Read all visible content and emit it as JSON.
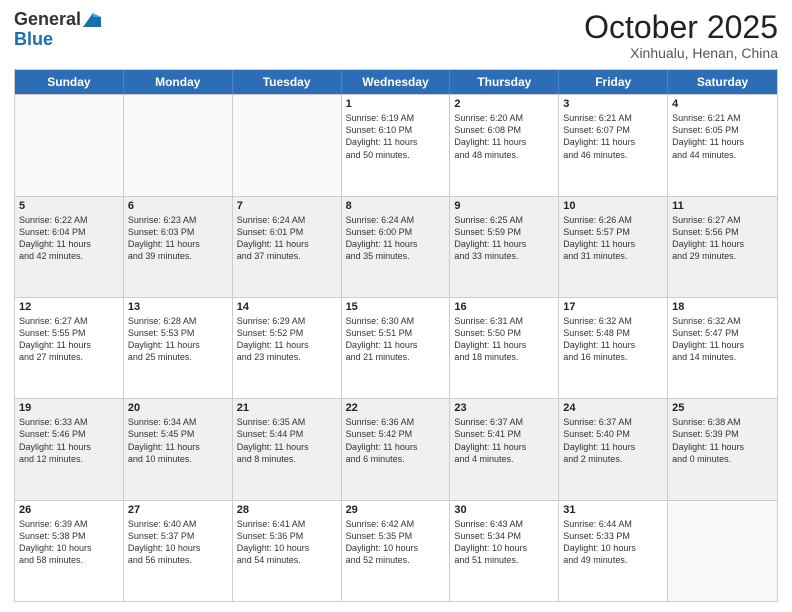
{
  "logo": {
    "line1": "General",
    "line2": "Blue"
  },
  "title": "October 2025",
  "location": "Xinhualu, Henan, China",
  "weekdays": [
    "Sunday",
    "Monday",
    "Tuesday",
    "Wednesday",
    "Thursday",
    "Friday",
    "Saturday"
  ],
  "rows": [
    [
      {
        "day": "",
        "info": "",
        "empty": true
      },
      {
        "day": "",
        "info": "",
        "empty": true
      },
      {
        "day": "",
        "info": "",
        "empty": true
      },
      {
        "day": "1",
        "info": "Sunrise: 6:19 AM\nSunset: 6:10 PM\nDaylight: 11 hours\nand 50 minutes."
      },
      {
        "day": "2",
        "info": "Sunrise: 6:20 AM\nSunset: 6:08 PM\nDaylight: 11 hours\nand 48 minutes."
      },
      {
        "day": "3",
        "info": "Sunrise: 6:21 AM\nSunset: 6:07 PM\nDaylight: 11 hours\nand 46 minutes."
      },
      {
        "day": "4",
        "info": "Sunrise: 6:21 AM\nSunset: 6:05 PM\nDaylight: 11 hours\nand 44 minutes."
      }
    ],
    [
      {
        "day": "5",
        "info": "Sunrise: 6:22 AM\nSunset: 6:04 PM\nDaylight: 11 hours\nand 42 minutes.",
        "shaded": true
      },
      {
        "day": "6",
        "info": "Sunrise: 6:23 AM\nSunset: 6:03 PM\nDaylight: 11 hours\nand 39 minutes.",
        "shaded": true
      },
      {
        "day": "7",
        "info": "Sunrise: 6:24 AM\nSunset: 6:01 PM\nDaylight: 11 hours\nand 37 minutes.",
        "shaded": true
      },
      {
        "day": "8",
        "info": "Sunrise: 6:24 AM\nSunset: 6:00 PM\nDaylight: 11 hours\nand 35 minutes.",
        "shaded": true
      },
      {
        "day": "9",
        "info": "Sunrise: 6:25 AM\nSunset: 5:59 PM\nDaylight: 11 hours\nand 33 minutes.",
        "shaded": true
      },
      {
        "day": "10",
        "info": "Sunrise: 6:26 AM\nSunset: 5:57 PM\nDaylight: 11 hours\nand 31 minutes.",
        "shaded": true
      },
      {
        "day": "11",
        "info": "Sunrise: 6:27 AM\nSunset: 5:56 PM\nDaylight: 11 hours\nand 29 minutes.",
        "shaded": true
      }
    ],
    [
      {
        "day": "12",
        "info": "Sunrise: 6:27 AM\nSunset: 5:55 PM\nDaylight: 11 hours\nand 27 minutes."
      },
      {
        "day": "13",
        "info": "Sunrise: 6:28 AM\nSunset: 5:53 PM\nDaylight: 11 hours\nand 25 minutes."
      },
      {
        "day": "14",
        "info": "Sunrise: 6:29 AM\nSunset: 5:52 PM\nDaylight: 11 hours\nand 23 minutes."
      },
      {
        "day": "15",
        "info": "Sunrise: 6:30 AM\nSunset: 5:51 PM\nDaylight: 11 hours\nand 21 minutes."
      },
      {
        "day": "16",
        "info": "Sunrise: 6:31 AM\nSunset: 5:50 PM\nDaylight: 11 hours\nand 18 minutes."
      },
      {
        "day": "17",
        "info": "Sunrise: 6:32 AM\nSunset: 5:48 PM\nDaylight: 11 hours\nand 16 minutes."
      },
      {
        "day": "18",
        "info": "Sunrise: 6:32 AM\nSunset: 5:47 PM\nDaylight: 11 hours\nand 14 minutes."
      }
    ],
    [
      {
        "day": "19",
        "info": "Sunrise: 6:33 AM\nSunset: 5:46 PM\nDaylight: 11 hours\nand 12 minutes.",
        "shaded": true
      },
      {
        "day": "20",
        "info": "Sunrise: 6:34 AM\nSunset: 5:45 PM\nDaylight: 11 hours\nand 10 minutes.",
        "shaded": true
      },
      {
        "day": "21",
        "info": "Sunrise: 6:35 AM\nSunset: 5:44 PM\nDaylight: 11 hours\nand 8 minutes.",
        "shaded": true
      },
      {
        "day": "22",
        "info": "Sunrise: 6:36 AM\nSunset: 5:42 PM\nDaylight: 11 hours\nand 6 minutes.",
        "shaded": true
      },
      {
        "day": "23",
        "info": "Sunrise: 6:37 AM\nSunset: 5:41 PM\nDaylight: 11 hours\nand 4 minutes.",
        "shaded": true
      },
      {
        "day": "24",
        "info": "Sunrise: 6:37 AM\nSunset: 5:40 PM\nDaylight: 11 hours\nand 2 minutes.",
        "shaded": true
      },
      {
        "day": "25",
        "info": "Sunrise: 6:38 AM\nSunset: 5:39 PM\nDaylight: 11 hours\nand 0 minutes.",
        "shaded": true
      }
    ],
    [
      {
        "day": "26",
        "info": "Sunrise: 6:39 AM\nSunset: 5:38 PM\nDaylight: 10 hours\nand 58 minutes."
      },
      {
        "day": "27",
        "info": "Sunrise: 6:40 AM\nSunset: 5:37 PM\nDaylight: 10 hours\nand 56 minutes."
      },
      {
        "day": "28",
        "info": "Sunrise: 6:41 AM\nSunset: 5:36 PM\nDaylight: 10 hours\nand 54 minutes."
      },
      {
        "day": "29",
        "info": "Sunrise: 6:42 AM\nSunset: 5:35 PM\nDaylight: 10 hours\nand 52 minutes."
      },
      {
        "day": "30",
        "info": "Sunrise: 6:43 AM\nSunset: 5:34 PM\nDaylight: 10 hours\nand 51 minutes."
      },
      {
        "day": "31",
        "info": "Sunrise: 6:44 AM\nSunset: 5:33 PM\nDaylight: 10 hours\nand 49 minutes."
      },
      {
        "day": "",
        "info": "",
        "empty": true
      }
    ]
  ]
}
